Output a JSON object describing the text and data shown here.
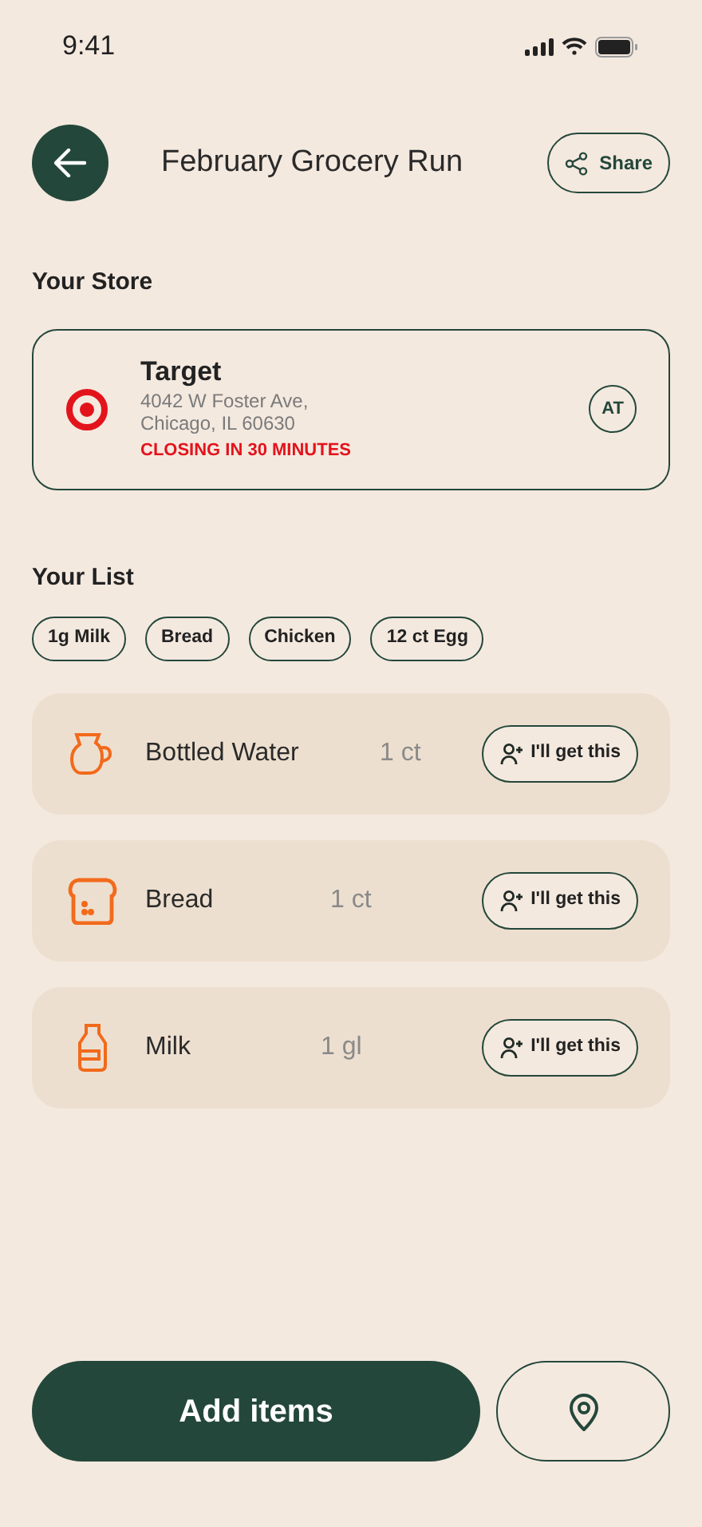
{
  "status_bar": {
    "time": "9:41"
  },
  "header": {
    "title": "February Grocery Run",
    "share_label": "Share"
  },
  "store": {
    "heading": "Your Store",
    "name": "Target",
    "address": "4042 W Foster Ave,\nChicago, IL 60630",
    "notice": "CLOSING IN 30 MINUTES",
    "initials": "AT"
  },
  "list": {
    "heading": "Your List",
    "chips": [
      "1g Milk",
      "Bread",
      "Chicken",
      "12 ct Egg"
    ],
    "items": [
      {
        "kind": "jug",
        "name": "Bottled Water",
        "quantity": "1 ct",
        "action": "I'll get this"
      },
      {
        "kind": "bread",
        "name": "Bread",
        "quantity": "1 ct",
        "action": "I'll get this"
      },
      {
        "kind": "bottle",
        "name": "Milk",
        "quantity": "1 gl",
        "action": "I'll get this"
      }
    ]
  },
  "footer": {
    "add_label": "Add items"
  }
}
